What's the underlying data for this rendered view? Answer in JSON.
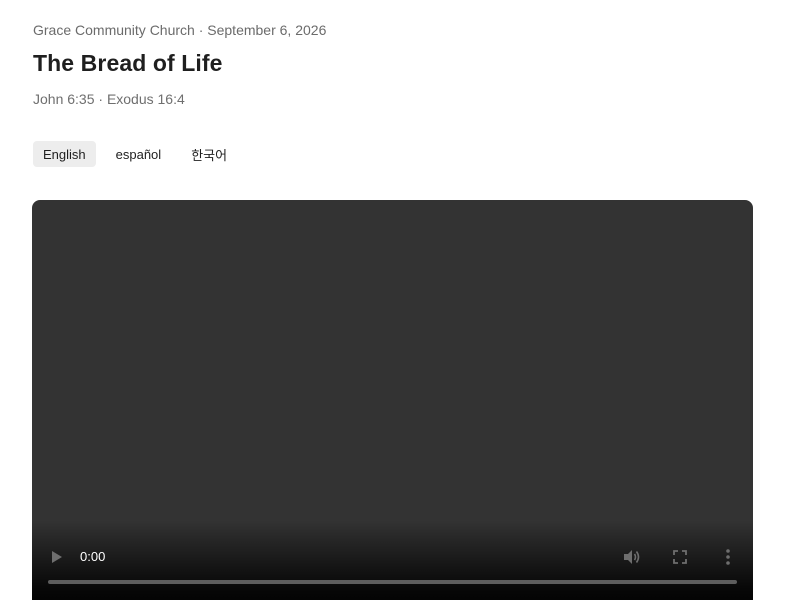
{
  "header": {
    "meta": "Grace Community Church · September 6, 2026",
    "title": "The Bread of Life",
    "scripture": "John 6:35 · Exodus 16:4"
  },
  "languages": [
    {
      "label": "English",
      "active": true
    },
    {
      "label": "español",
      "active": false
    },
    {
      "label": "한국어",
      "active": false
    }
  ],
  "player": {
    "time": "0:00",
    "progress": 0,
    "icons": [
      "play-icon",
      "volume-icon",
      "fullscreen-icon",
      "more-vertical-icon"
    ],
    "colors": {
      "video_bg": "#333333",
      "control_text": "#ffffff"
    }
  }
}
